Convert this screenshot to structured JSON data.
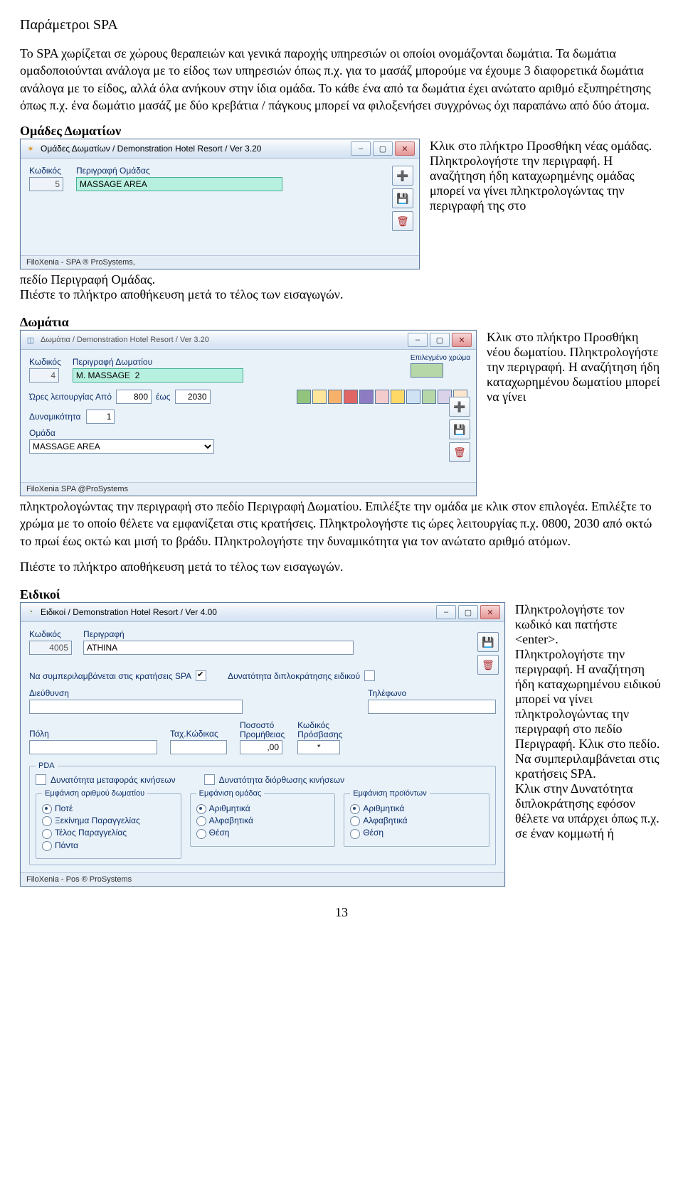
{
  "title": "Παράμετροι SPA",
  "intro_para": "Το SPA χωρίζεται σε χώρους θεραπειών και γενικά παροχής υπηρεσιών οι οποίοι ονομάζονται δωμάτια. Τα δωμάτια ομαδοποιούνται ανάλογα με το είδος των υπηρεσιών όπως π.χ. για το μασάζ μπορούμε να έχουμε 3 διαφορετικά δωμάτια ανάλογα με το είδος, αλλά όλα ανήκουν στην ίδια ομάδα. Το κάθε ένα από τα δωμάτια έχει ανώτατο αριθμό εξυπηρέτησης όπως π.χ. ένα δωμάτιο μασάζ με δύο κρεβάτια / πάγκους μπορεί να φιλοξενήσει συγχρόνως όχι παραπάνω από δύο άτομα.",
  "section1": {
    "heading": "Ομάδες Δωματίων",
    "win": {
      "title": "Ομάδες Δωματίων        / Demonstration Hotel Resort   /  Ver  3.20",
      "icon_glyph": "✶",
      "labels": {
        "code": "Κωδικός",
        "desc": "Περιγραφή Ομάδας"
      },
      "code_value": "5",
      "desc_value": "MASSAGE AREA",
      "footer": "FiloXenia - SPA ® ProSystems,"
    },
    "side_text": "Κλικ στο πλήκτρο Προσθήκη νέας ομάδας. Πληκτρολογήστε την περιγραφή. Η αναζήτηση ήδη καταχωρημένης ομάδας μπορεί να γίνει πληκτρολογώντας την περιγραφή της στο",
    "after1": "πεδίο Περιγραφή Ομάδας.",
    "after2": "Πιέστε το πλήκτρο αποθήκευση μετά το τέλος των εισαγωγών."
  },
  "section2": {
    "heading": "Δωμάτια",
    "win": {
      "title": "Δωμάτια             / Demonstration Hotel Resort   /  Ver  3.20",
      "icon_glyph": "◫",
      "labels": {
        "code": "Κωδικός",
        "desc": "Περιγραφή Δωματίου",
        "hours": "Ώρες λειτουργίας Από",
        "to": "έως",
        "capacity": "Δυναμικότητα",
        "group": "Ομάδα",
        "sel_color": "Επιλεγμένο χρώμα"
      },
      "code_value": "4",
      "desc_value": "M. MASSAGE  2",
      "from_value": "800",
      "to_value": "2030",
      "capacity_value": "1",
      "group_value": "MASSAGE AREA",
      "swatches": [
        "#93c47d",
        "#ffe599",
        "#f6b26b",
        "#e06666",
        "#8e7cc3",
        "#f4cccc",
        "#ffd966",
        "#cfe2f3",
        "#b6d7a8",
        "#d9d2e9",
        "#fce5cd"
      ],
      "footer": "FiloXenia  SPA  @ProSystems"
    },
    "side_text": "Κλικ στο πλήκτρο Προσθήκη νέου δωματίου. Πληκτρολογήστε την περιγραφή. Η αναζήτηση ήδη καταχωρημένου δωματίου μπορεί να γίνει",
    "after": "πληκτρολογώντας την περιγραφή στο πεδίο Περιγραφή Δωματίου. Επιλέξτε την ομάδα με κλικ στον επιλογέα. Επιλέξτε το χρώμα με το οποίο θέλετε να εμφανίζεται στις κρατήσεις. Πληκτρολογήστε τις ώρες λειτουργίας π.χ. 0800, 2030 από οκτώ το πρωί έως οκτώ και μισή το βράδυ. Πληκτρολογήστε την δυναμικότητα για τον ανώτατο αριθμό ατόμων.",
    "after2": "Πιέστε το πλήκτρο αποθήκευση μετά το τέλος των εισαγωγών."
  },
  "section3": {
    "heading": "Ειδικοί",
    "win": {
      "title": "Ειδικοί             / Demonstration Hotel Resort   /  Ver  4.00",
      "icon_glyph": "◔",
      "labels": {
        "code": "Κωδικός",
        "desc": "Περιγραφή",
        "include": "Να συμπεριλαμβάνεται στις κρατήσεις SPA",
        "double": "Δυνατότητα διπλοκράτησης ειδικού",
        "address": "Διεύθυνση",
        "phone": "Τηλέφωνο",
        "city": "Πόλη",
        "tax_code": "Ταχ.Κώδικας",
        "commission": "Ποσοστό\nΠρομήθειας",
        "access_code": "Κωδικός\nΠρόσβασης",
        "commission_value": ",00",
        "access_value": "*",
        "pda": "PDA",
        "transfer": "Δυνατότητα μεταφοράς κινήσεων",
        "edit": "Δυνατότητα διόρθωσης κινήσεων",
        "g_room": "Εμφάνιση αριθμού δωματίου",
        "g_group": "Εμφάνιση ομάδας",
        "g_prod": "Εμφάνιση προϊόντων",
        "r_never": "Ποτέ",
        "r_start": "Ξεκίνημα Παραγγελίας",
        "r_end": "Τέλος Παραγγελίας",
        "r_always": "Πάντα",
        "r_num": "Αριθμητικά",
        "r_alpha": "Αλφαβητικά",
        "r_pos": "Θέση"
      },
      "code_value": "4005",
      "desc_value": "ATHINA",
      "footer": "FiloXenia - Pos ® ProSystems"
    },
    "side_text": "Πληκτρολογήστε τον κωδικό και πατήστε <enter>.\nΠληκτρολογήστε την περιγραφή. Η αναζήτηση ήδη καταχωρημένου ειδικού μπορεί να γίνει πληκτρολογώντας την περιγραφή στο πεδίο Περιγραφή. Κλικ στο πεδίο.\nΝα συμπεριλαμβάνεται στις κρατήσεις SPA.\nΚλικ στην Δυνατότητα διπλοκράτησης εφόσον θέλετε να υπάρχει όπως π.χ. σε έναν κομμωτή ή"
  },
  "page_number": "13"
}
